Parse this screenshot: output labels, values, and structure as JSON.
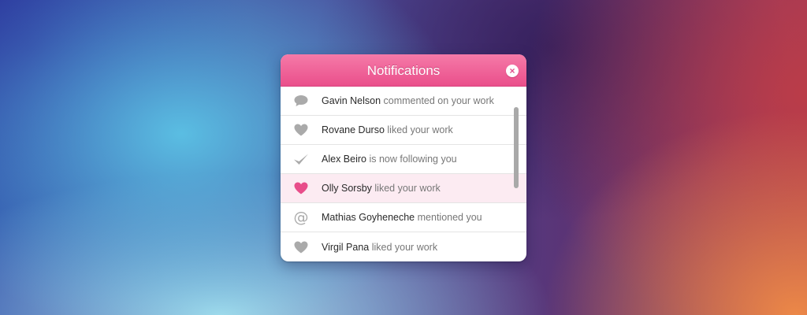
{
  "header": {
    "title": "Notifications",
    "close_symbol": "×"
  },
  "colors": {
    "header_top": "#f57aa8",
    "header_bottom": "#ea4f8b",
    "highlight_row": "#fcebf2",
    "heart_active": "#e84d8a",
    "icon_gray": "#aaaaaa"
  },
  "notifications": [
    {
      "icon": "comment-icon",
      "name": "Gavin Nelson",
      "action": "commented on your work",
      "highlighted": false
    },
    {
      "icon": "heart-icon",
      "name": "Rovane Durso",
      "action": "liked your work",
      "highlighted": false
    },
    {
      "icon": "checkmark-icon",
      "name": "Alex Beiro",
      "action": "is now following you",
      "highlighted": false
    },
    {
      "icon": "heart-icon",
      "name": "Olly Sorsby",
      "action": "liked your work",
      "highlighted": true
    },
    {
      "icon": "at-sign-icon",
      "name": "Mathias Goyheneche",
      "action": "mentioned you",
      "at_glyph": "@",
      "highlighted": false
    },
    {
      "icon": "heart-icon",
      "name": "Virgil Pana",
      "action": "liked your work",
      "highlighted": false
    }
  ]
}
